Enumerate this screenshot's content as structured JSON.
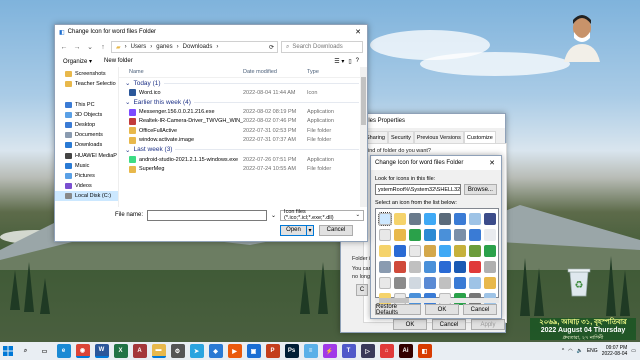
{
  "desktop": {
    "recycle_bin_icon": "recycle-bin-icon"
  },
  "calendar_overlay": {
    "line1": "২০৬৯, আষাঢ় ৩১, বৃহস্পতিবার",
    "line2": "2022 August 04 Thursday",
    "line3": "ধ্রুবতারা, ২৭ নাগিনী"
  },
  "open_dialog": {
    "title": "Change Icon for word files Folder",
    "path": [
      "Users",
      "ganes",
      "Downloads"
    ],
    "search_placeholder": "Search Downloads",
    "organize": "Organize ▾",
    "new_folder": "New folder",
    "nav_items": [
      {
        "label": "Screenshots",
        "icon": "folder-icon",
        "color": "#e8b84b"
      },
      {
        "label": "Teacher Selectio",
        "icon": "folder-icon",
        "color": "#e8b84b"
      },
      {
        "label": "",
        "icon": "",
        "color": ""
      },
      {
        "label": "This PC",
        "icon": "computer-icon",
        "color": "#3a7bd5"
      },
      {
        "label": "3D Objects",
        "icon": "cube-icon",
        "color": "#5aa0e6"
      },
      {
        "label": "Desktop",
        "icon": "desktop-icon",
        "color": "#3a7bd5"
      },
      {
        "label": "Documents",
        "icon": "documents-icon",
        "color": "#8a9bb0"
      },
      {
        "label": "Downloads",
        "icon": "download-icon",
        "color": "#2a7ad4"
      },
      {
        "label": "HUAWEI MediaP",
        "icon": "phone-icon",
        "color": "#444"
      },
      {
        "label": "Music",
        "icon": "music-icon",
        "color": "#2a7ad4"
      },
      {
        "label": "Pictures",
        "icon": "pictures-icon",
        "color": "#5aa0e6"
      },
      {
        "label": "Videos",
        "icon": "videos-icon",
        "color": "#7a4fd0"
      },
      {
        "label": "Local Disk (C:)",
        "icon": "drive-icon",
        "color": "#888"
      }
    ],
    "columns": {
      "name": "Name",
      "date": "Date modified",
      "type": "Type"
    },
    "groups": [
      {
        "title": "Today (1)",
        "files": [
          {
            "name": "Word.ico",
            "date": "2022-08-04 11:44 AM",
            "type": "Icon",
            "color": "#2b579a"
          }
        ]
      },
      {
        "title": "Earlier this week (4)",
        "files": [
          {
            "name": "Messenger.156.0.0.21.216.exe",
            "date": "2022-08-02 08:19 PM",
            "type": "Application",
            "color": "#7b4bff"
          },
          {
            "name": "Realtek-IR-Camera-Driver_TWVGH_WIN_...",
            "date": "2022-08-02 07:46 PM",
            "type": "Application",
            "color": "#c23b3b"
          },
          {
            "name": "OfficeFullActive",
            "date": "2022-07-31 02:53 PM",
            "type": "File folder",
            "color": "#e8b84b"
          },
          {
            "name": "window.activate.image",
            "date": "2022-07-31 07:37 AM",
            "type": "File folder",
            "color": "#e8b84b"
          }
        ]
      },
      {
        "title": "Last week (3)",
        "files": [
          {
            "name": "android-studio-2021.2.1.15-windows.exe",
            "date": "2022-07-26 07:51 PM",
            "type": "Application",
            "color": "#3ddc84"
          },
          {
            "name": "SuperMeg",
            "date": "2022-07-24 10:55 AM",
            "type": "File folder",
            "color": "#e8b84b"
          }
        ]
      }
    ],
    "filename_label": "File name:",
    "filename_value": "",
    "filetype_value": "Icon files (*.ico;*.icl;*.exe;*.dll)",
    "open_btn": "Open",
    "cancel_btn": "Cancel"
  },
  "props_window": {
    "title": "iles Properties",
    "tabs": [
      "Sharing",
      "Security",
      "Previous Versions",
      "Customize"
    ],
    "text1": "ind of folder do you want?",
    "text2": "Folder ic",
    "text3": "You can",
    "text4": "no longe",
    "ok": "OK",
    "cancel": "Cancel",
    "apply": "Apply"
  },
  "icon_dialog": {
    "title": "Change Icon for word files Folder",
    "look_label": "Look for icons in this file:",
    "path_value": "ystemRoot%\\System32\\SHELL32.dll",
    "browse": "Browse...",
    "select_label": "Select an icon from the list below:",
    "restore": "Restore Defaults",
    "ok": "OK",
    "cancel": "Cancel",
    "icon_colors": [
      "#ffffff",
      "#f5d36b",
      "#6a7b8c",
      "#3fa9f5",
      "#5b6b7b",
      "#3a7bd5",
      "#9ec3e6",
      "#3c4c8a",
      "#e8e8e8",
      "#e8b84b",
      "#2aa14a",
      "#2a8ad4",
      "#4a90d9",
      "#7a8fa8",
      "#3a7bd5",
      "#e9ebef",
      "#f5d36b",
      "#2a6ad4",
      "#e8e8e8",
      "#d4a84b",
      "#3fa9f5",
      "#c6b13b",
      "#6b9c3b",
      "#2aa14a",
      "#8a9bb0",
      "#d04a3a",
      "#c0c0c0",
      "#4a90d9",
      "#2a6ad4",
      "#1a5ab4",
      "#e03a3a",
      "#b0b0b0",
      "#e8e8e8",
      "#8b8b8b",
      "#d0d8e0",
      "#5a8ad4",
      "#c0c0c0",
      "#3a7bd5",
      "#9ec3e6",
      "#e8b84b",
      "#f5d36b",
      "#e8e8e8",
      "#4a90d9",
      "#3a7bd5",
      "#e8e8e8",
      "#2aa14a",
      "#777",
      "#9ec3e6"
    ]
  },
  "taskbar": {
    "icons": [
      {
        "name": "search-icon",
        "color": "#e9eef3",
        "label": "⌕",
        "fg": "#333"
      },
      {
        "name": "task-view-icon",
        "color": "#e9eef3",
        "label": "▭",
        "fg": "#333"
      },
      {
        "name": "edge-icon",
        "color": "#1a8ad4",
        "label": "e"
      },
      {
        "name": "chrome-icon",
        "color": "#db4437",
        "label": "◉"
      },
      {
        "name": "word-icon",
        "color": "#2b579a",
        "label": "W"
      },
      {
        "name": "excel-icon",
        "color": "#217346",
        "label": "X"
      },
      {
        "name": "access-icon",
        "color": "#a4373a",
        "label": "A"
      },
      {
        "name": "file-explorer-icon",
        "color": "#e8b84b",
        "label": "▬"
      },
      {
        "name": "settings-icon",
        "color": "#555",
        "label": "⚙"
      },
      {
        "name": "telegram-icon",
        "color": "#2aa4df",
        "label": "➤"
      },
      {
        "name": "maps-icon",
        "color": "#2a7ad4",
        "label": "◆"
      },
      {
        "name": "video-player-icon",
        "color": "#ea5a0c",
        "label": "▶"
      },
      {
        "name": "photos-icon",
        "color": "#1a6fd4",
        "label": "▣"
      },
      {
        "name": "powerpoint-icon",
        "color": "#c43e1c",
        "label": "P"
      },
      {
        "name": "photoshop-icon",
        "color": "#001e36",
        "label": "Ps"
      },
      {
        "name": "notepad-icon",
        "color": "#5ab0e8",
        "label": "≡"
      },
      {
        "name": "messenger-icon",
        "color": "#a03ae8",
        "label": "⚡"
      },
      {
        "name": "teams-icon",
        "color": "#5059c9",
        "label": "T"
      },
      {
        "name": "video-editor-icon",
        "color": "#3a3a5a",
        "label": "▷"
      },
      {
        "name": "acrobat-icon",
        "color": "#e03a3a",
        "label": "⌂"
      },
      {
        "name": "illustrator-icon",
        "color": "#330000",
        "label": "Ai"
      },
      {
        "name": "app-icon",
        "color": "#d83b01",
        "label": "◧"
      }
    ],
    "lang": "ENG",
    "time": "09:07 PM",
    "date": "2022-08-04"
  }
}
